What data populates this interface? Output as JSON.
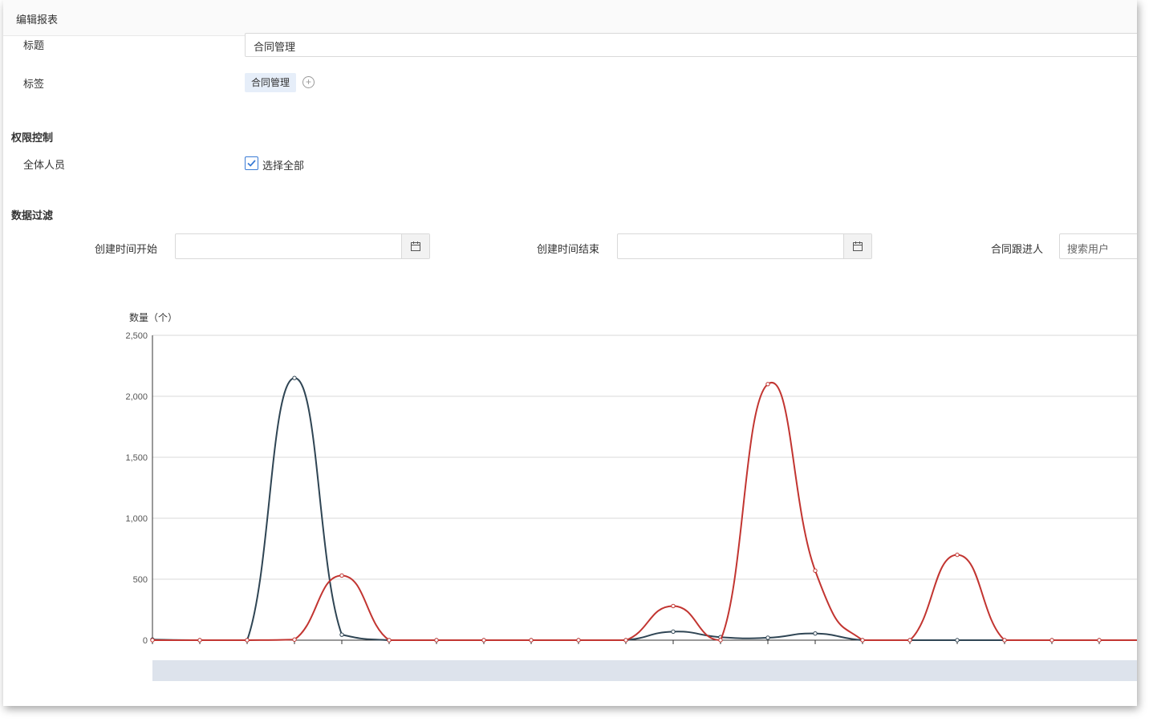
{
  "window": {
    "title": "编辑报表"
  },
  "form": {
    "title_label": "标题",
    "title_value": "合同管理",
    "tags_label": "标签",
    "tags": [
      "合同管理"
    ],
    "permission_section": "权限控制",
    "all_staff_label": "全体人员",
    "select_all_label": "选择全部",
    "filter_section": "数据过滤",
    "create_start_label": "创建时间开始",
    "create_end_label": "创建时间结束",
    "follower_label": "合同跟进人",
    "follower_placeholder": "搜索用户"
  },
  "icons": {
    "calendar": "calendar-icon",
    "add": "plus-circle-icon",
    "check": "check-icon"
  },
  "colors": {
    "series_dark": "#2f4554",
    "series_red": "#c23531",
    "checkbox": "#3a7bd5"
  },
  "chart_data": {
    "type": "line",
    "ylabel": "数量（个）",
    "ylim": [
      0,
      2500
    ],
    "yticks": [
      0,
      500,
      1000,
      1500,
      2000,
      2500
    ],
    "ytick_labels": [
      "0",
      "500",
      "1,000",
      "1,500",
      "2,000",
      "2,500"
    ],
    "x": [
      0,
      1,
      2,
      3,
      4,
      5,
      6,
      7,
      8,
      9,
      10,
      11,
      12,
      13,
      14,
      15,
      16,
      17,
      18,
      19,
      20,
      21,
      22
    ],
    "grid": true,
    "smooth": true,
    "series": [
      {
        "color": "#2f4554",
        "values": [
          5,
          0,
          0,
          2150,
          45,
          0,
          0,
          0,
          0,
          0,
          0,
          70,
          25,
          20,
          55,
          0,
          0,
          0,
          0,
          0,
          0,
          0,
          50
        ]
      },
      {
        "color": "#c23531",
        "values": [
          0,
          0,
          0,
          5,
          530,
          0,
          0,
          0,
          0,
          0,
          0,
          280,
          0,
          2100,
          570,
          0,
          0,
          700,
          0,
          0,
          0,
          0,
          0
        ]
      }
    ]
  }
}
